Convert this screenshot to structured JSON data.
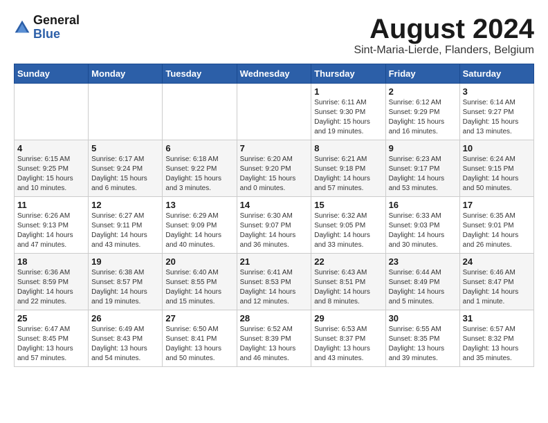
{
  "header": {
    "logo_general": "General",
    "logo_blue": "Blue",
    "main_title": "August 2024",
    "subtitle": "Sint-Maria-Lierde, Flanders, Belgium"
  },
  "days_of_week": [
    "Sunday",
    "Monday",
    "Tuesday",
    "Wednesday",
    "Thursday",
    "Friday",
    "Saturday"
  ],
  "weeks": [
    [
      {
        "day": "",
        "detail": ""
      },
      {
        "day": "",
        "detail": ""
      },
      {
        "day": "",
        "detail": ""
      },
      {
        "day": "",
        "detail": ""
      },
      {
        "day": "1",
        "detail": "Sunrise: 6:11 AM\nSunset: 9:30 PM\nDaylight: 15 hours\nand 19 minutes."
      },
      {
        "day": "2",
        "detail": "Sunrise: 6:12 AM\nSunset: 9:29 PM\nDaylight: 15 hours\nand 16 minutes."
      },
      {
        "day": "3",
        "detail": "Sunrise: 6:14 AM\nSunset: 9:27 PM\nDaylight: 15 hours\nand 13 minutes."
      }
    ],
    [
      {
        "day": "4",
        "detail": "Sunrise: 6:15 AM\nSunset: 9:25 PM\nDaylight: 15 hours\nand 10 minutes."
      },
      {
        "day": "5",
        "detail": "Sunrise: 6:17 AM\nSunset: 9:24 PM\nDaylight: 15 hours\nand 6 minutes."
      },
      {
        "day": "6",
        "detail": "Sunrise: 6:18 AM\nSunset: 9:22 PM\nDaylight: 15 hours\nand 3 minutes."
      },
      {
        "day": "7",
        "detail": "Sunrise: 6:20 AM\nSunset: 9:20 PM\nDaylight: 15 hours\nand 0 minutes."
      },
      {
        "day": "8",
        "detail": "Sunrise: 6:21 AM\nSunset: 9:18 PM\nDaylight: 14 hours\nand 57 minutes."
      },
      {
        "day": "9",
        "detail": "Sunrise: 6:23 AM\nSunset: 9:17 PM\nDaylight: 14 hours\nand 53 minutes."
      },
      {
        "day": "10",
        "detail": "Sunrise: 6:24 AM\nSunset: 9:15 PM\nDaylight: 14 hours\nand 50 minutes."
      }
    ],
    [
      {
        "day": "11",
        "detail": "Sunrise: 6:26 AM\nSunset: 9:13 PM\nDaylight: 14 hours\nand 47 minutes."
      },
      {
        "day": "12",
        "detail": "Sunrise: 6:27 AM\nSunset: 9:11 PM\nDaylight: 14 hours\nand 43 minutes."
      },
      {
        "day": "13",
        "detail": "Sunrise: 6:29 AM\nSunset: 9:09 PM\nDaylight: 14 hours\nand 40 minutes."
      },
      {
        "day": "14",
        "detail": "Sunrise: 6:30 AM\nSunset: 9:07 PM\nDaylight: 14 hours\nand 36 minutes."
      },
      {
        "day": "15",
        "detail": "Sunrise: 6:32 AM\nSunset: 9:05 PM\nDaylight: 14 hours\nand 33 minutes."
      },
      {
        "day": "16",
        "detail": "Sunrise: 6:33 AM\nSunset: 9:03 PM\nDaylight: 14 hours\nand 30 minutes."
      },
      {
        "day": "17",
        "detail": "Sunrise: 6:35 AM\nSunset: 9:01 PM\nDaylight: 14 hours\nand 26 minutes."
      }
    ],
    [
      {
        "day": "18",
        "detail": "Sunrise: 6:36 AM\nSunset: 8:59 PM\nDaylight: 14 hours\nand 22 minutes."
      },
      {
        "day": "19",
        "detail": "Sunrise: 6:38 AM\nSunset: 8:57 PM\nDaylight: 14 hours\nand 19 minutes."
      },
      {
        "day": "20",
        "detail": "Sunrise: 6:40 AM\nSunset: 8:55 PM\nDaylight: 14 hours\nand 15 minutes."
      },
      {
        "day": "21",
        "detail": "Sunrise: 6:41 AM\nSunset: 8:53 PM\nDaylight: 14 hours\nand 12 minutes."
      },
      {
        "day": "22",
        "detail": "Sunrise: 6:43 AM\nSunset: 8:51 PM\nDaylight: 14 hours\nand 8 minutes."
      },
      {
        "day": "23",
        "detail": "Sunrise: 6:44 AM\nSunset: 8:49 PM\nDaylight: 14 hours\nand 5 minutes."
      },
      {
        "day": "24",
        "detail": "Sunrise: 6:46 AM\nSunset: 8:47 PM\nDaylight: 14 hours\nand 1 minute."
      }
    ],
    [
      {
        "day": "25",
        "detail": "Sunrise: 6:47 AM\nSunset: 8:45 PM\nDaylight: 13 hours\nand 57 minutes."
      },
      {
        "day": "26",
        "detail": "Sunrise: 6:49 AM\nSunset: 8:43 PM\nDaylight: 13 hours\nand 54 minutes."
      },
      {
        "day": "27",
        "detail": "Sunrise: 6:50 AM\nSunset: 8:41 PM\nDaylight: 13 hours\nand 50 minutes."
      },
      {
        "day": "28",
        "detail": "Sunrise: 6:52 AM\nSunset: 8:39 PM\nDaylight: 13 hours\nand 46 minutes."
      },
      {
        "day": "29",
        "detail": "Sunrise: 6:53 AM\nSunset: 8:37 PM\nDaylight: 13 hours\nand 43 minutes."
      },
      {
        "day": "30",
        "detail": "Sunrise: 6:55 AM\nSunset: 8:35 PM\nDaylight: 13 hours\nand 39 minutes."
      },
      {
        "day": "31",
        "detail": "Sunrise: 6:57 AM\nSunset: 8:32 PM\nDaylight: 13 hours\nand 35 minutes."
      }
    ]
  ]
}
